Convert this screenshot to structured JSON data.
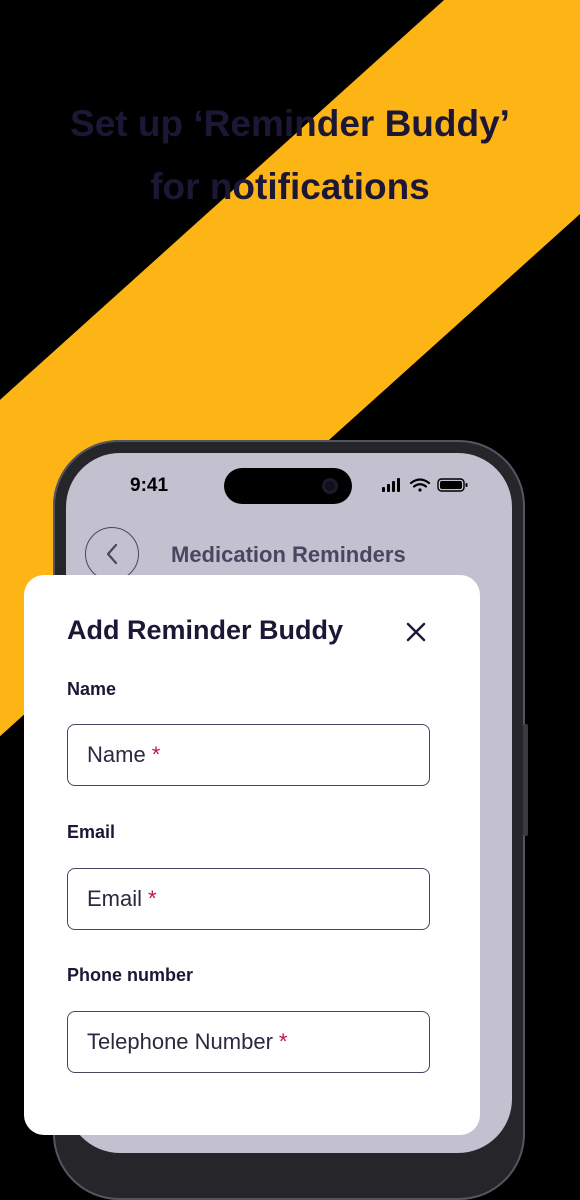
{
  "headline": {
    "line1": "Set up ‘Reminder Buddy’",
    "line2": "for notifications"
  },
  "status_bar": {
    "time": "9:41",
    "icons": [
      "signal-icon",
      "wifi-icon",
      "battery-icon"
    ]
  },
  "nav": {
    "back_icon": "chevron-left-icon",
    "title": "Medication Reminders"
  },
  "sheet": {
    "title": "Add Reminder Buddy",
    "close_icon": "close-icon",
    "fields": [
      {
        "label": "Name",
        "placeholder": "Name",
        "required_mark": "*"
      },
      {
        "label": "Email",
        "placeholder": "Email",
        "required_mark": "*"
      },
      {
        "label": "Phone number",
        "placeholder": "Telephone Number",
        "required_mark": "*"
      }
    ]
  },
  "colors": {
    "background": "#000000",
    "accent_stripe": "#FDB515",
    "headline": "#1d1736",
    "screen": "#c3c1d0",
    "sheet": "#ffffff",
    "required": "#c8104a"
  }
}
